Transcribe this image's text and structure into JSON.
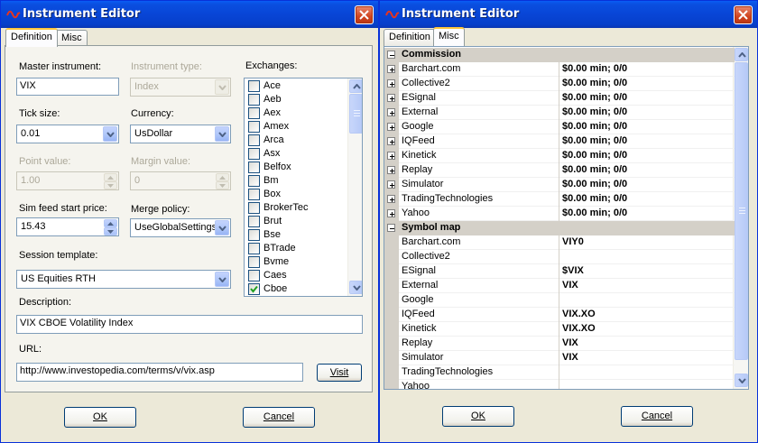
{
  "left": {
    "title": "Instrument Editor",
    "tabs": [
      "Definition",
      "Misc"
    ],
    "fields": {
      "master_label": "Master instrument:",
      "master_value": "VIX",
      "type_label": "Instrument type:",
      "type_value": "Index",
      "exchanges_label": "Exchanges:",
      "tick_label": "Tick size:",
      "tick_value": "0.01",
      "currency_label": "Currency:",
      "currency_value": "UsDollar",
      "point_label": "Point value:",
      "point_value": "1.00",
      "margin_label": "Margin value:",
      "margin_value": "0",
      "sim_label": "Sim feed start price:",
      "sim_value": "15.43",
      "merge_label": "Merge policy:",
      "merge_value": "UseGlobalSettings",
      "session_label": "Session template:",
      "session_value": "US Equities RTH",
      "desc_label": "Description:",
      "desc_value": "VIX CBOE Volatility Index",
      "url_label": "URL:",
      "url_value": "http://www.investopedia.com/terms/v/vix.asp"
    },
    "exchanges": [
      {
        "name": "Ace",
        "checked": false
      },
      {
        "name": "Aeb",
        "checked": false
      },
      {
        "name": "Aex",
        "checked": false
      },
      {
        "name": "Amex",
        "checked": false
      },
      {
        "name": "Arca",
        "checked": false
      },
      {
        "name": "Asx",
        "checked": false
      },
      {
        "name": "Belfox",
        "checked": false
      },
      {
        "name": "Bm",
        "checked": false
      },
      {
        "name": "Box",
        "checked": false
      },
      {
        "name": "BrokerTec",
        "checked": false
      },
      {
        "name": "Brut",
        "checked": false
      },
      {
        "name": "Bse",
        "checked": false
      },
      {
        "name": "BTrade",
        "checked": false
      },
      {
        "name": "Bvme",
        "checked": false
      },
      {
        "name": "Caes",
        "checked": false
      },
      {
        "name": "Cboe",
        "checked": true
      }
    ],
    "buttons": {
      "visit": "Visit",
      "ok": "OK",
      "cancel": "Cancel"
    }
  },
  "right": {
    "title": "Instrument Editor",
    "tabs": [
      "Definition",
      "Misc"
    ],
    "commission_title": "Commission",
    "commission": [
      {
        "name": "Barchart.com",
        "value": "$0.00 min;  0/0"
      },
      {
        "name": "Collective2",
        "value": "$0.00 min;  0/0"
      },
      {
        "name": "ESignal",
        "value": "$0.00 min;  0/0"
      },
      {
        "name": "External",
        "value": "$0.00 min;  0/0"
      },
      {
        "name": "Google",
        "value": "$0.00 min;  0/0"
      },
      {
        "name": "IQFeed",
        "value": "$0.00 min;  0/0"
      },
      {
        "name": "Kinetick",
        "value": "$0.00 min;  0/0"
      },
      {
        "name": "Replay",
        "value": "$0.00 min;  0/0"
      },
      {
        "name": "Simulator",
        "value": "$0.00 min;  0/0"
      },
      {
        "name": "TradingTechnologies",
        "value": "$0.00 min;  0/0"
      },
      {
        "name": "Yahoo",
        "value": "$0.00 min;  0/0"
      }
    ],
    "symbol_title": "Symbol map",
    "symbols": [
      {
        "name": "Barchart.com",
        "value": "VIY0"
      },
      {
        "name": "Collective2",
        "value": ""
      },
      {
        "name": "ESignal",
        "value": "$VIX"
      },
      {
        "name": "External",
        "value": "VIX"
      },
      {
        "name": "Google",
        "value": ""
      },
      {
        "name": "IQFeed",
        "value": "VIX.XO"
      },
      {
        "name": "Kinetick",
        "value": "VIX.XO"
      },
      {
        "name": "Replay",
        "value": "VIX"
      },
      {
        "name": "Simulator",
        "value": "VIX"
      },
      {
        "name": "TradingTechnologies",
        "value": ""
      },
      {
        "name": "Yahoo",
        "value": ""
      }
    ],
    "buttons": {
      "ok": "OK",
      "cancel": "Cancel"
    }
  },
  "colors": {
    "titlebar": "#0845d6",
    "check": "#21a121"
  }
}
